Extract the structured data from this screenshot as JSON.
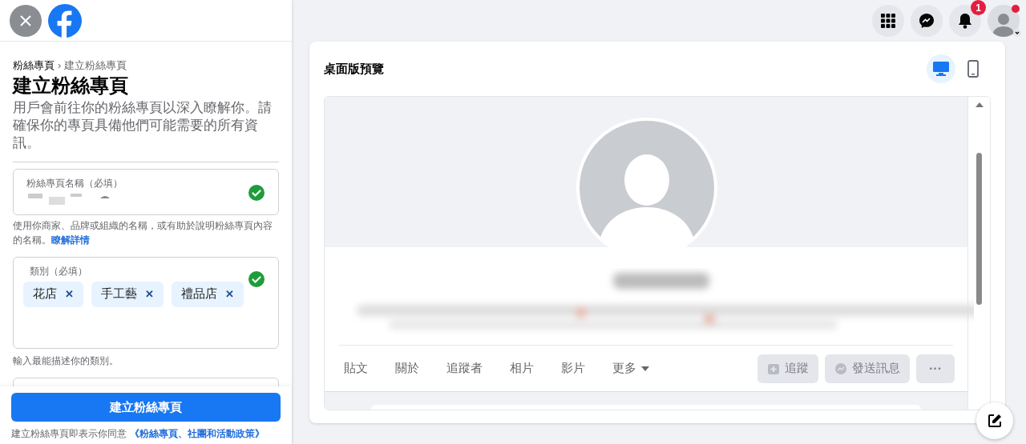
{
  "sidebar": {
    "breadcrumb": {
      "parent": "粉絲專頁",
      "separator": "›",
      "current": "建立粉絲專頁"
    },
    "title": "建立粉絲專頁",
    "description": "用戶會前往你的粉絲專頁以深入瞭解你。請確保你的專頁具備他們可能需要的所有資訊。",
    "name_field": {
      "label": "粉絲專頁名稱（必填）",
      "valid": true
    },
    "name_help": "使用你商家、品牌或組織的名稱，或有助於說明粉絲專頁內容的名稱。",
    "name_help_link": "瞭解詳情",
    "category_field": {
      "label": "類別（必填）",
      "valid": true,
      "tags": [
        {
          "label": "花店",
          "remove": "✕"
        },
        {
          "label": "手工藝",
          "remove": "✕"
        },
        {
          "label": "禮品店",
          "remove": "✕"
        }
      ]
    },
    "category_help": "輸入最能描述你的類別。",
    "create_button": "建立粉絲專頁",
    "terms": "建立粉絲專頁即表示你同意",
    "terms_link": "《粉絲專頁、社團和活動政策》"
  },
  "topbar": {
    "notifications_badge": "1",
    "profile_dot": true
  },
  "preview": {
    "title": "桌面版預覽",
    "devices": [
      {
        "kind": "desktop",
        "selected": true
      },
      {
        "kind": "mobile",
        "selected": false
      }
    ],
    "tabs": [
      {
        "label": "貼文",
        "selected": false
      },
      {
        "label": "關於",
        "selected": false
      },
      {
        "label": "追蹤者",
        "selected": false
      },
      {
        "label": "相片",
        "selected": false
      },
      {
        "label": "影片",
        "selected": false
      },
      {
        "label": "更多",
        "selected": false,
        "dropdown": true
      }
    ],
    "actions": [
      {
        "kind": "follow",
        "label": "追蹤",
        "disabled": true
      },
      {
        "kind": "message",
        "label": "發送訊息",
        "disabled": true
      },
      {
        "kind": "more",
        "label": "···",
        "disabled": true
      }
    ]
  }
}
